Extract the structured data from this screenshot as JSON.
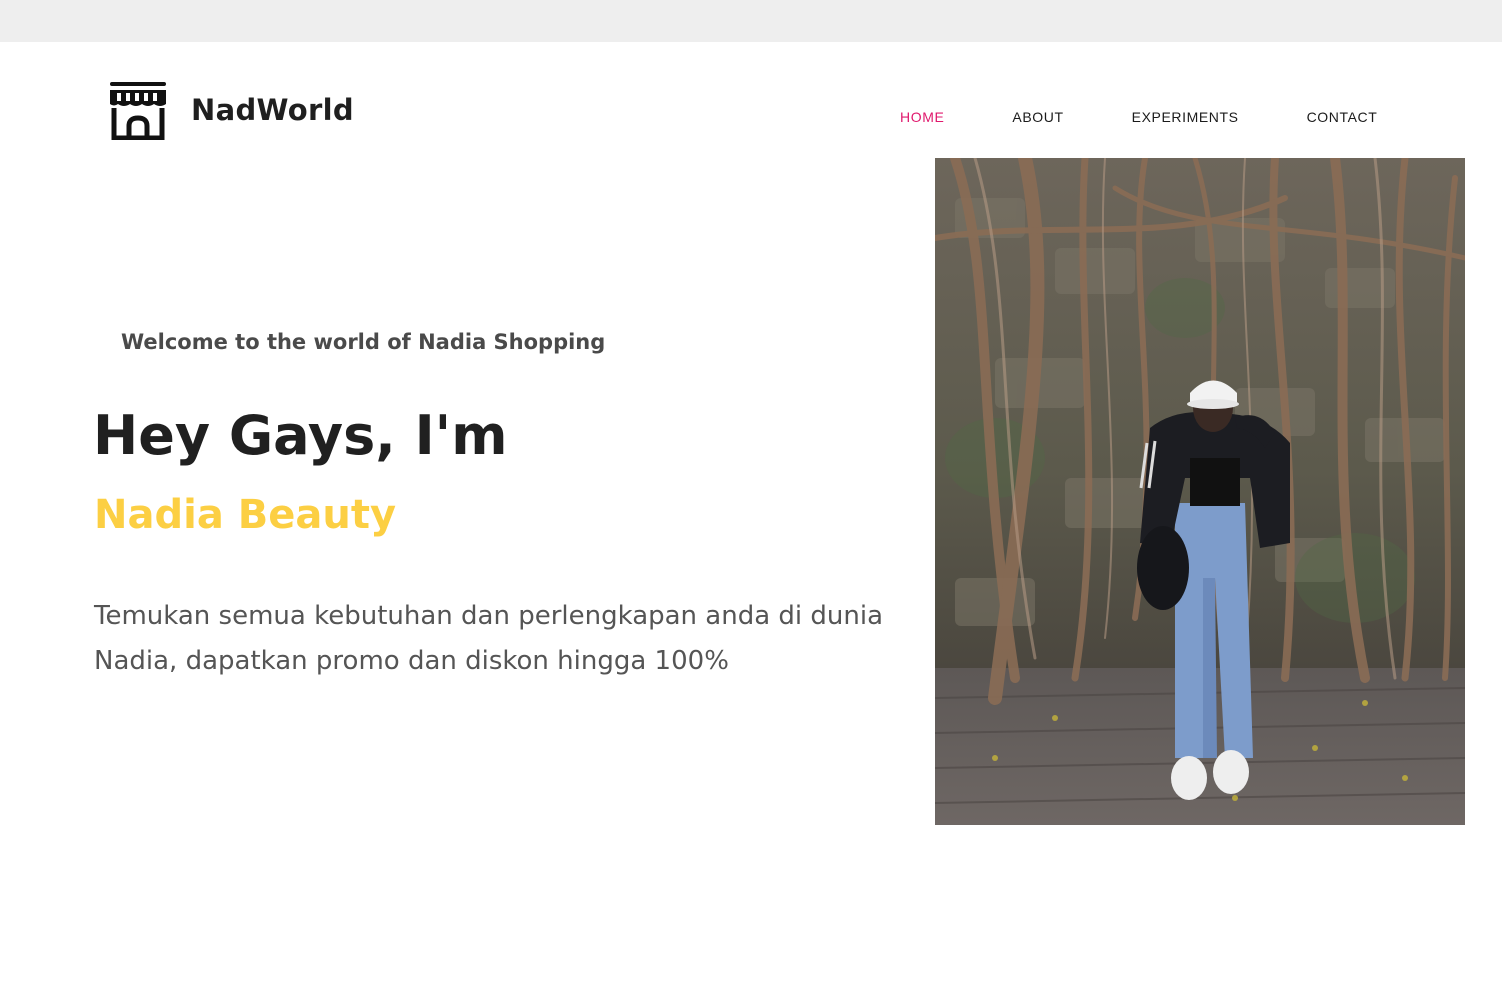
{
  "header": {
    "brand": "NadWorld",
    "logo_icon": "storefront-icon",
    "nav": [
      {
        "label": "HOME",
        "active": true
      },
      {
        "label": "ABOUT",
        "active": false
      },
      {
        "label": "EXPERIMENTS",
        "active": false
      },
      {
        "label": "CONTACT",
        "active": false
      }
    ]
  },
  "hero": {
    "welcome": "Welcome to the world of Nadia Shopping",
    "greeting": "Hey Gays, I'm",
    "name": "Nadia Beauty",
    "description": "Temukan semua kebutuhan dan perlengkapan anda di dunia Nadia, dapatkan promo dan diskon hingga 100%"
  },
  "colors": {
    "nav_active": "#e0196d",
    "name_accent": "#fccf43",
    "text_dark": "#202020",
    "text_muted": "#555555"
  }
}
